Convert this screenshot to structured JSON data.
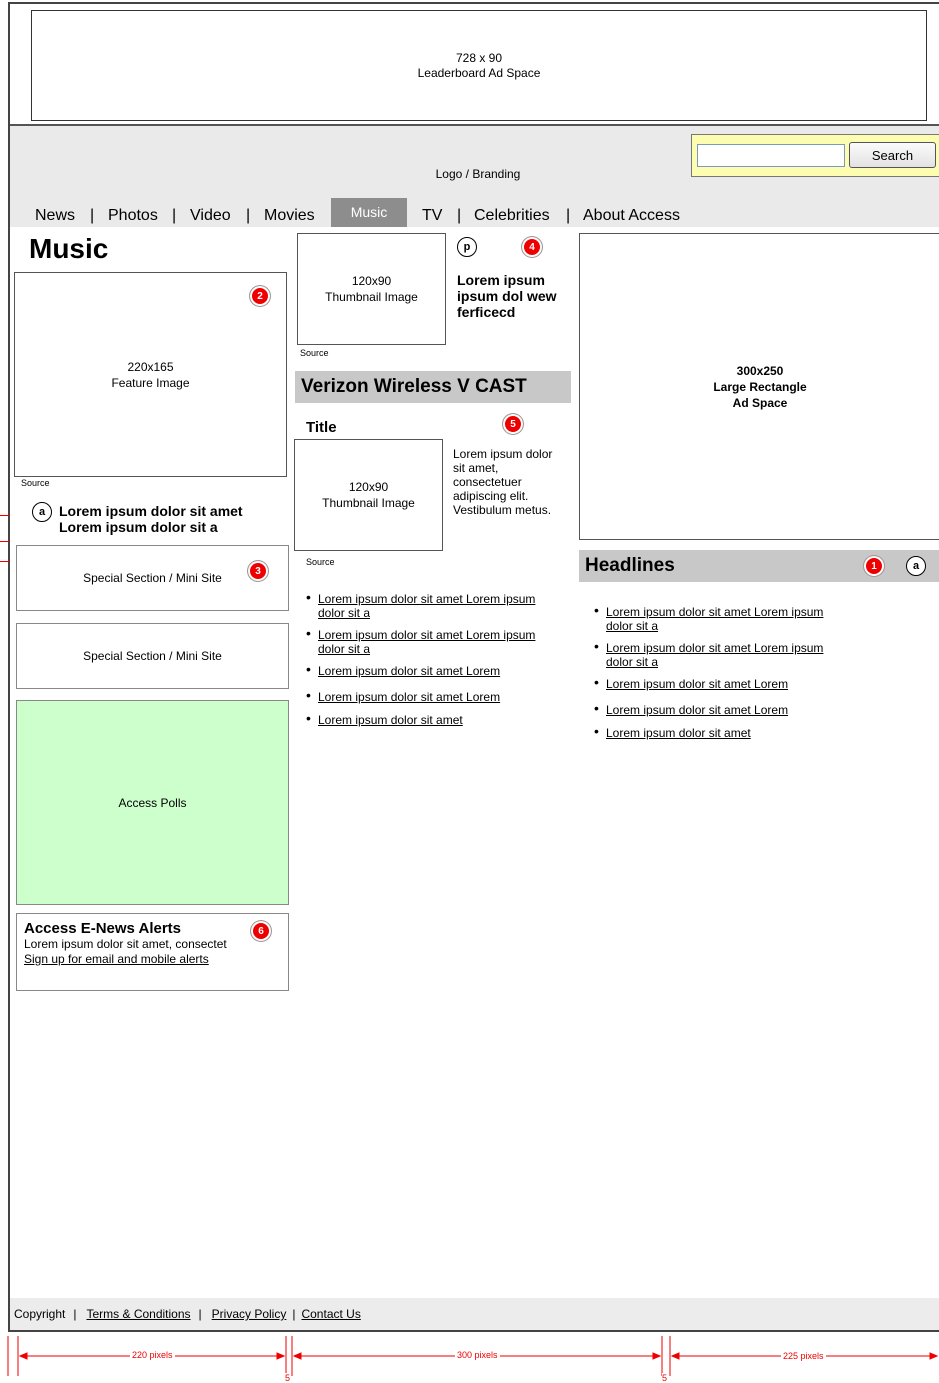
{
  "leaderboard": {
    "line1": "728 x 90",
    "line2": "Leaderboard Ad Space"
  },
  "search": {
    "value": "",
    "button_label": "Search"
  },
  "logo_text": "Logo / Branding",
  "nav": {
    "items": [
      "News",
      "Photos",
      "Video",
      "Movies",
      "Music",
      "TV",
      "Celebrities",
      "About Access"
    ],
    "active": "Music",
    "separator": "|"
  },
  "page_title": "Music",
  "feature": {
    "line1": "220x165",
    "line2": "Feature Image",
    "source": "Source",
    "badge": "2"
  },
  "feature_caption": {
    "marker": "a",
    "line1": "Lorem ipsum dolor sit amet",
    "line2": "Lorem ipsum dolor sit a"
  },
  "special_sections": [
    {
      "label": "Special Section / Mini Site",
      "badge": "3"
    },
    {
      "label": "Special Section / Mini Site"
    }
  ],
  "polls": {
    "label": "Access Polls",
    "bg_color": "#ccffcc"
  },
  "alerts": {
    "title": "Access E-News Alerts",
    "text": "Lorem ipsum dolor sit amet, consectet",
    "link": "Sign up for email and mobile  alerts",
    "badge": "6"
  },
  "promo": {
    "thumb_line1": "120x90",
    "thumb_line2": "Thumbnail Image",
    "source": "Source",
    "marker": "p",
    "badge": "4",
    "headline": [
      "Lorem ipsum",
      "ipsum dol wew",
      "ferficecd"
    ]
  },
  "vcast": {
    "title": "Verizon Wireless V CAST",
    "item_title": "Title",
    "badge": "5",
    "thumb_line1": "120x90",
    "thumb_line2": "Thumbnail Image",
    "source": "Source",
    "text_lines": [
      "Lorem ipsum dolor",
      "sit amet,",
      "consectetuer",
      "adipiscing elit.",
      "Vestibulum metus."
    ],
    "links": [
      [
        "Lorem ipsum dolor sit amet Lorem ipsum",
        "dolor sit a"
      ],
      [
        "Lorem ipsum dolor sit amet Lorem ipsum",
        "dolor sit a"
      ],
      [
        "Lorem ipsum dolor sit amet Lorem"
      ],
      [
        "Lorem ipsum dolor sit amet Lorem"
      ],
      [
        "Lorem ipsum dolor sit amet"
      ]
    ]
  },
  "ad_rect": {
    "line1": "300x250",
    "line2": "Large Rectangle",
    "line3": "Ad Space"
  },
  "headlines": {
    "title": "Headlines",
    "badge": "1",
    "marker": "a",
    "links": [
      [
        "Lorem ipsum dolor sit amet Lorem ipsum",
        "dolor sit a"
      ],
      [
        "Lorem ipsum dolor sit amet Lorem ipsum",
        "dolor sit a"
      ],
      [
        "Lorem ipsum dolor sit amet Lorem"
      ],
      [
        "Lorem ipsum dolor sit amet Lorem"
      ],
      [
        "Lorem ipsum dolor sit amet"
      ]
    ]
  },
  "footer": {
    "copyright": "Copyright",
    "links": [
      "Terms & Conditions",
      "Privacy Policy",
      "Contact Us"
    ],
    "separator": "|"
  },
  "dimensions": {
    "col1": "220 pixels",
    "col2": "300 pixels",
    "col3": "225 pixels",
    "gap": "5",
    "color": "#ee0000"
  }
}
